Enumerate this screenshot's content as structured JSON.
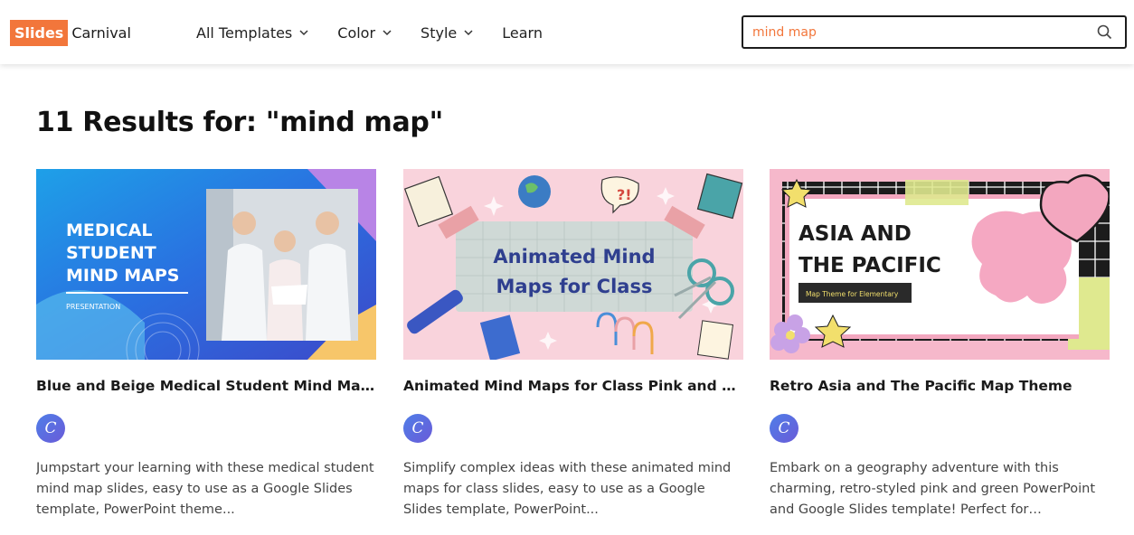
{
  "header": {
    "logo_left": "Slides",
    "logo_right": "Carnival",
    "nav": [
      {
        "label": "All Templates",
        "has_dropdown": true
      },
      {
        "label": "Color",
        "has_dropdown": true
      },
      {
        "label": "Style",
        "has_dropdown": true
      },
      {
        "label": "Learn",
        "has_dropdown": false
      }
    ],
    "search": {
      "value": "mind map",
      "icon": "search-icon"
    }
  },
  "results": {
    "title": "11 Results for: \"mind map\""
  },
  "cards": [
    {
      "title": "Blue and Beige Medical Student Mind Maps Presentation",
      "avatar": "C",
      "description": "Jumpstart your learning with these medical student mind map slides, easy to use as a Google Slides template, PowerPoint theme...",
      "thumb_heading": [
        "MEDICAL",
        "STUDENT",
        "MIND MAPS"
      ],
      "thumb_sub": "PRESENTATION"
    },
    {
      "title": "Animated Mind Maps for Class Pink and Blue Presentation",
      "avatar": "C",
      "description": "Simplify complex ideas with these animated mind maps for class slides, easy to use as a Google Slides template, PowerPoint...",
      "thumb_heading": [
        "Animated Mind",
        "Maps for Class"
      ],
      "thumb_sub": ""
    },
    {
      "title": "Retro Asia and The Pacific Map Theme",
      "avatar": "C",
      "description": "Embark on a geography adventure with this charming, retro-styled pink and green PowerPoint and Google Slides template! Perfect for educators...",
      "thumb_heading": [
        "ASIA AND",
        "THE PACIFIC"
      ],
      "thumb_sub": "Map Theme for Elementary"
    }
  ],
  "colors": {
    "brand": "#f2763b",
    "text": "#1c1c1c"
  }
}
